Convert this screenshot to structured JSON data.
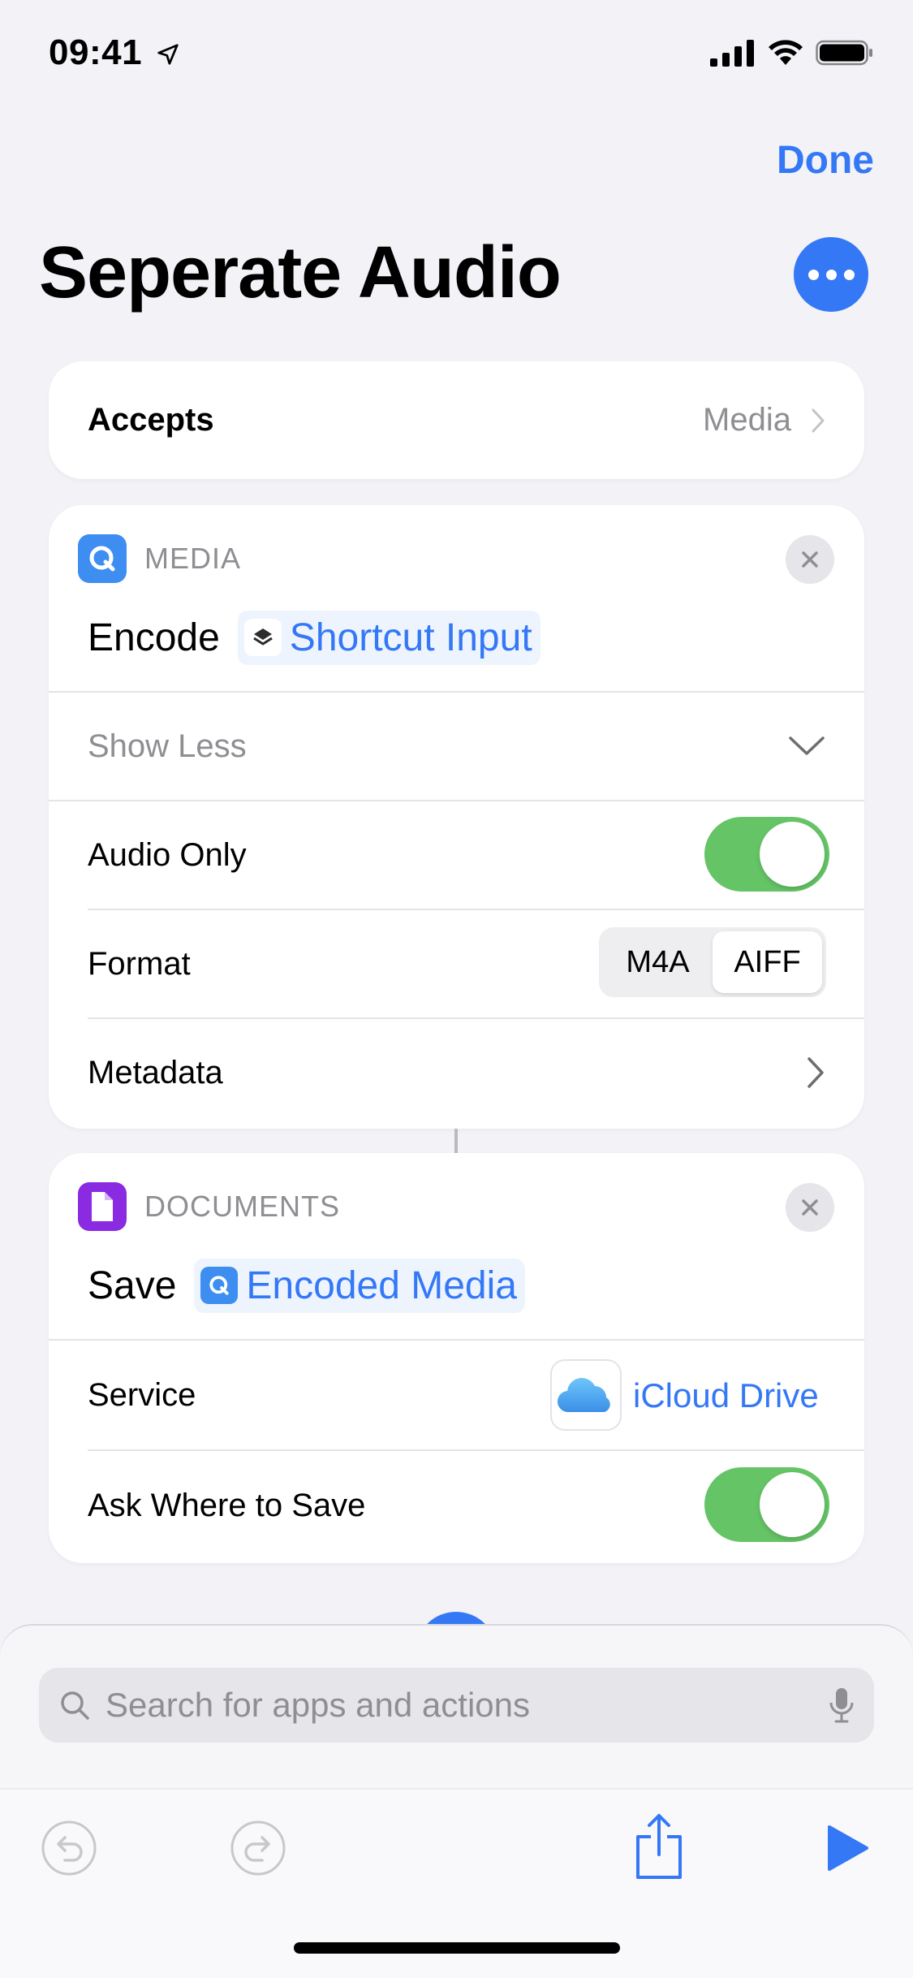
{
  "status_bar": {
    "time": "09:41"
  },
  "header": {
    "done_label": "Done",
    "title": "Seperate Audio"
  },
  "accepts": {
    "label": "Accepts",
    "value": "Media"
  },
  "encode_action": {
    "category": "MEDIA",
    "verb": "Encode",
    "input_token": "Shortcut Input",
    "show_less_label": "Show Less",
    "audio_only": {
      "label": "Audio Only",
      "on": true
    },
    "format": {
      "label": "Format",
      "options": [
        "M4A",
        "AIFF"
      ],
      "selected": "AIFF"
    },
    "metadata_label": "Metadata"
  },
  "save_action": {
    "category": "DOCUMENTS",
    "verb": "Save",
    "input_token": "Encoded Media",
    "service": {
      "label": "Service",
      "value": "iCloud Drive"
    },
    "ask_where": {
      "label": "Ask Where to Save",
      "on": true
    }
  },
  "search": {
    "placeholder": "Search for apps and actions"
  },
  "colors": {
    "accent": "#3478f6",
    "toggle_on": "#65c466",
    "media_icon": "#3d8ef0",
    "documents_icon": "#8a2be2"
  }
}
